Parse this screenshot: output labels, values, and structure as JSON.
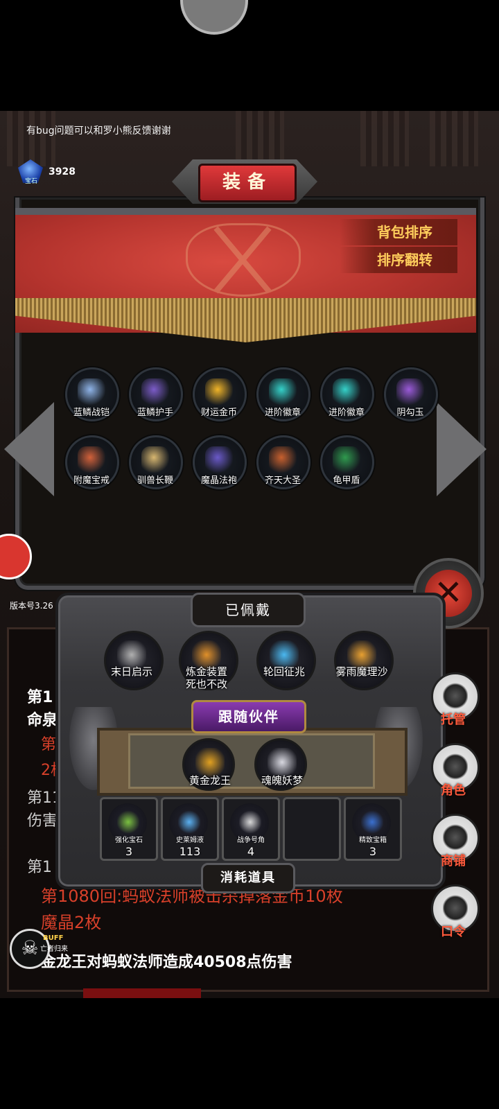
{
  "feedback_notice": "有bug问题可以和罗小熊反馈谢谢",
  "currency": {
    "label": "宝石",
    "value": "3928",
    "icon": "blue-gem-icon"
  },
  "equipment_panel": {
    "title": "装备",
    "sort_buttons": [
      "背包排序",
      "排序翻转"
    ],
    "items": [
      {
        "name": "蓝鳞战铠",
        "icon": "blue-armor-icon",
        "color": "#8fb4e8"
      },
      {
        "name": "蓝鳞护手",
        "icon": "gauntlet-icon",
        "color": "#7c5cc9"
      },
      {
        "name": "财运金币",
        "icon": "gold-coin-icon",
        "color": "#f0b428"
      },
      {
        "name": "进阶徽章",
        "icon": "teal-badge-icon",
        "color": "#35d1c9"
      },
      {
        "name": "进阶徽章",
        "icon": "teal-badge-icon",
        "color": "#35d1c9"
      },
      {
        "name": "阴勾玉",
        "icon": "purple-magatama-icon",
        "color": "#9a5ad8"
      },
      {
        "name": "附魔宝戒",
        "icon": "ring-icon",
        "color": "#d2613a"
      },
      {
        "name": "驯兽长鞭",
        "icon": "whip-icon",
        "color": "#d8b770"
      },
      {
        "name": "魔晶法袍",
        "icon": "wizard-robe-icon",
        "color": "#6a59c8"
      },
      {
        "name": "齐天大圣",
        "icon": "monkey-king-icon",
        "color": "#c8602e"
      },
      {
        "name": "龟甲盾",
        "icon": "turtle-shield-icon",
        "color": "#2f9a4e"
      }
    ]
  },
  "version": "版本号3.26",
  "log_lines": [
    {
      "text": "第1",
      "color": "#ffffff"
    },
    {
      "text": "命泉",
      "color": "#ffffff"
    },
    {
      "text": "第",
      "color": "#d8402a"
    },
    {
      "text": "2枚",
      "color": "#d8402a"
    },
    {
      "text": "第11",
      "color": "#cfcfcf"
    },
    {
      "text": "伤害",
      "color": "#cfcfcf"
    },
    {
      "text": "第1",
      "color": "#cfcfcf"
    },
    {
      "text": "第1080回:蚂蚁法师被击杀掉落金币10枚",
      "color": "#d8402a"
    },
    {
      "text": "魔晶2枚",
      "color": "#d8402a"
    },
    {
      "text": "金龙王对蚂蚁法师造成40508点伤害",
      "color": "#ffffff"
    }
  ],
  "worn_panel": {
    "title": "已佩戴",
    "items": [
      {
        "name": "末日启示",
        "icon": "crossed-weapons-icon",
        "color": "#b0b0b0"
      },
      {
        "name": "炼金装置\n死也不改",
        "icon": "potion-flask-icon",
        "color": "#e0902a"
      },
      {
        "name": "轮回征兆",
        "icon": "ice-staff-icon",
        "color": "#4ab8f0"
      },
      {
        "name": "雾雨魔理沙",
        "icon": "witch-girl-icon",
        "color": "#e8a030"
      }
    ]
  },
  "partners": {
    "title": "跟随伙伴",
    "items": [
      {
        "name": "黄金龙王",
        "icon": "golden-dragon-icon",
        "color": "#e0a020"
      },
      {
        "name": "魂魄妖梦",
        "icon": "swordswoman-icon",
        "color": "#d8d8e0"
      }
    ]
  },
  "consumables": {
    "title": "消耗道具",
    "slots": [
      {
        "name": "强化宝石",
        "count": "3",
        "icon": "green-crystal-icon",
        "color": "#7ac040"
      },
      {
        "name": "史莱姆液",
        "count": "113",
        "icon": "slime-bottle-icon",
        "color": "#5ab0f0"
      },
      {
        "name": "战争号角",
        "count": "4",
        "icon": "war-horn-icon",
        "color": "#d8d8d8"
      },
      {
        "name": "",
        "count": "",
        "icon": "",
        "color": ""
      },
      {
        "name": "精致宝箱",
        "count": "3",
        "icon": "treasure-chest-icon",
        "color": "#3a70d0"
      }
    ]
  },
  "side_buttons": [
    {
      "label": "托管",
      "icon": "dice-icon"
    },
    {
      "label": "角色",
      "icon": "hooded-character-icon"
    },
    {
      "label": "商铺",
      "icon": "shop-icon"
    },
    {
      "label": "口令",
      "icon": "scroll-icon"
    }
  ],
  "buff": {
    "label": "BUFF",
    "sub": "亡者归来",
    "icon": "skull-icon"
  }
}
